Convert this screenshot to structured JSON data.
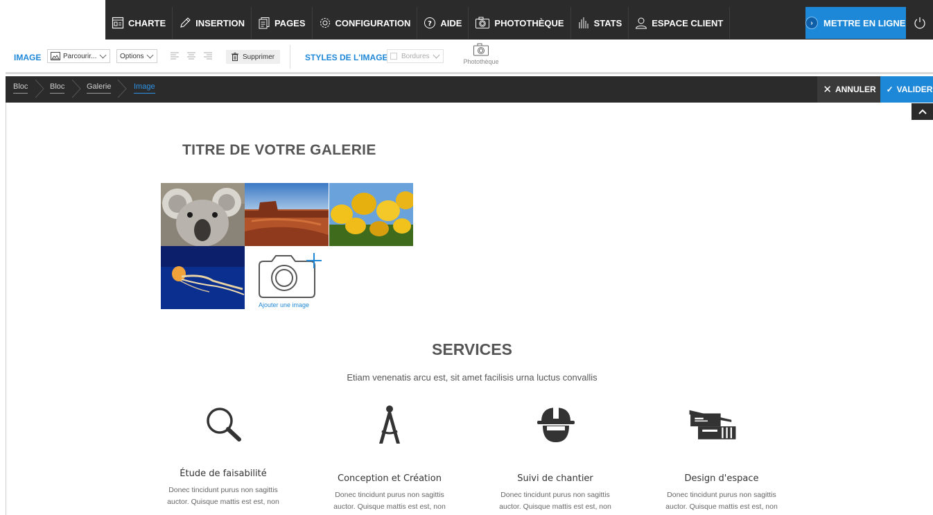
{
  "menu": {
    "items": [
      {
        "label": "CHARTE",
        "icon": "layout-icon"
      },
      {
        "label": "INSERTION",
        "icon": "pencil-icon"
      },
      {
        "label": "PAGES",
        "icon": "pages-icon"
      },
      {
        "label": "CONFIGURATION",
        "icon": "gear-icon"
      },
      {
        "label": "AIDE",
        "icon": "help-icon"
      },
      {
        "label": "PHOTOTHÈQUE",
        "icon": "camera-icon"
      },
      {
        "label": "STATS",
        "icon": "stats-icon"
      },
      {
        "label": "ESPACE CLIENT",
        "icon": "user-icon"
      }
    ],
    "publish_label": "METTRE EN LIGNE"
  },
  "toolbar": {
    "image_label": "IMAGE",
    "browse_label": "Parcourir...",
    "options_label": "Options",
    "delete_label": "Supprimer",
    "styles_label": "STYLES DE L'IMAGE",
    "borders_label": "Bordures",
    "phototheque_label": "Photothèque"
  },
  "breadcrumb": {
    "items": [
      "Bloc",
      "Bloc",
      "Galerie",
      "Image"
    ],
    "cancel_label": "ANNULER",
    "validate_label": "VALIDER"
  },
  "gallery": {
    "title": "TITRE DE VOTRE GALERIE",
    "images": [
      "koala",
      "desert",
      "tulips",
      "jellyfish"
    ],
    "add_label": "Ajouter une image"
  },
  "services": {
    "title": "SERVICES",
    "subtitle": "Etiam venenatis arcu est, sit amet facilisis urna luctus convallis",
    "items": [
      {
        "title": "Étude de faisabilité",
        "icon": "search-icon",
        "line1": "Donec tincidunt purus non sagittis",
        "line2": "auctor. Quisque mattis est est, non"
      },
      {
        "title": "Conception et Création",
        "icon": "compass-icon",
        "line1": "Donec tincidunt purus non sagittis",
        "line2": "auctor. Quisque mattis est est, non"
      },
      {
        "title": "Suivi de chantier",
        "icon": "helmet-icon",
        "line1": "Donec tincidunt purus non sagittis",
        "line2": "auctor. Quisque mattis est est, non"
      },
      {
        "title": "Design d'espace",
        "icon": "building-icon",
        "line1": "Donec tincidunt purus non sagittis",
        "line2": "auctor. Quisque mattis est est, non"
      }
    ]
  },
  "colors": {
    "accent": "#1e88d8",
    "dark_bar": "#2b2b2b",
    "heading": "#555555"
  }
}
